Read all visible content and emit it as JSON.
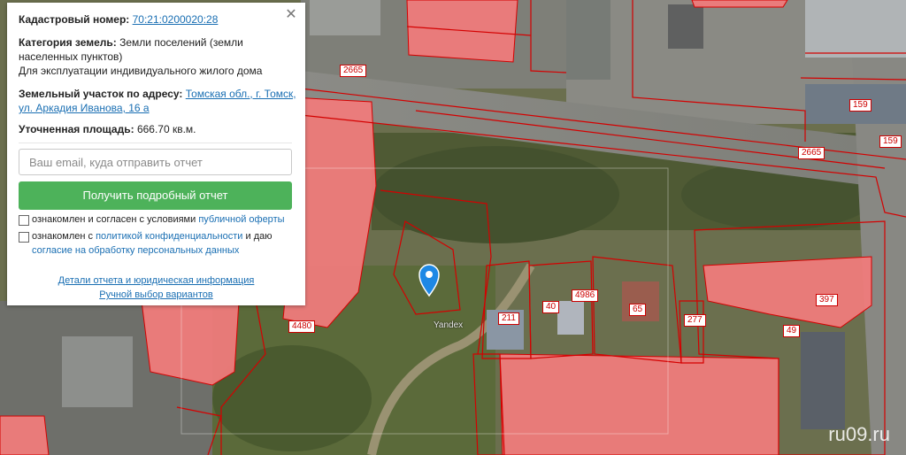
{
  "panel": {
    "cadastral_label": "Кадастровый номер:",
    "cadastral_value": "70:21:0200020:28",
    "category_label": "Категория земель:",
    "category_value_1": "Земли поселений (земли",
    "category_value_2": "населенных пунктов)",
    "usage": "Для эксплуатации индивидуального жилого дома",
    "address_label": "Земельный участок по адресу:",
    "address_value_1": "Томская обл., г. Томск,",
    "address_value_2": "ул. Аркадия Иванова, 16 а",
    "area_label": "Уточненная площадь:",
    "area_value": "666.70 кв.м.",
    "email_placeholder": "Ваш email, куда отправить отчет",
    "submit_label": "Получить подробный отчет",
    "consent1_text": "ознакомлен и согласен с условиями",
    "consent1_link": "публичной оферты",
    "consent2_text_a": "ознакомлен с",
    "consent2_link_a": "политикой конфиденциальности",
    "consent2_text_b": "и даю",
    "consent2_link_b": "согласие на обработку персональных данных",
    "details_link": "Детали отчета и юридическая информация",
    "manual_link": "Ручной выбор вариантов",
    "close_icon": "close-icon"
  },
  "map": {
    "labels": {
      "l2665a": "2665",
      "l2665b": "2665",
      "l159a": "159",
      "l159b": "159",
      "l4480": "4480",
      "l211": "211",
      "l40": "40",
      "l4986": "4986",
      "l65": "65",
      "l277": "277",
      "l397": "397",
      "l49": "49"
    },
    "yandex": "Yandex",
    "watermark": "ru09.ru",
    "marker_icon": "map-pin-icon"
  },
  "colors": {
    "parcel_fill": "#ef7b7b",
    "boundary": "#d40000",
    "button": "#4db25a",
    "link": "#1a6fb3"
  }
}
